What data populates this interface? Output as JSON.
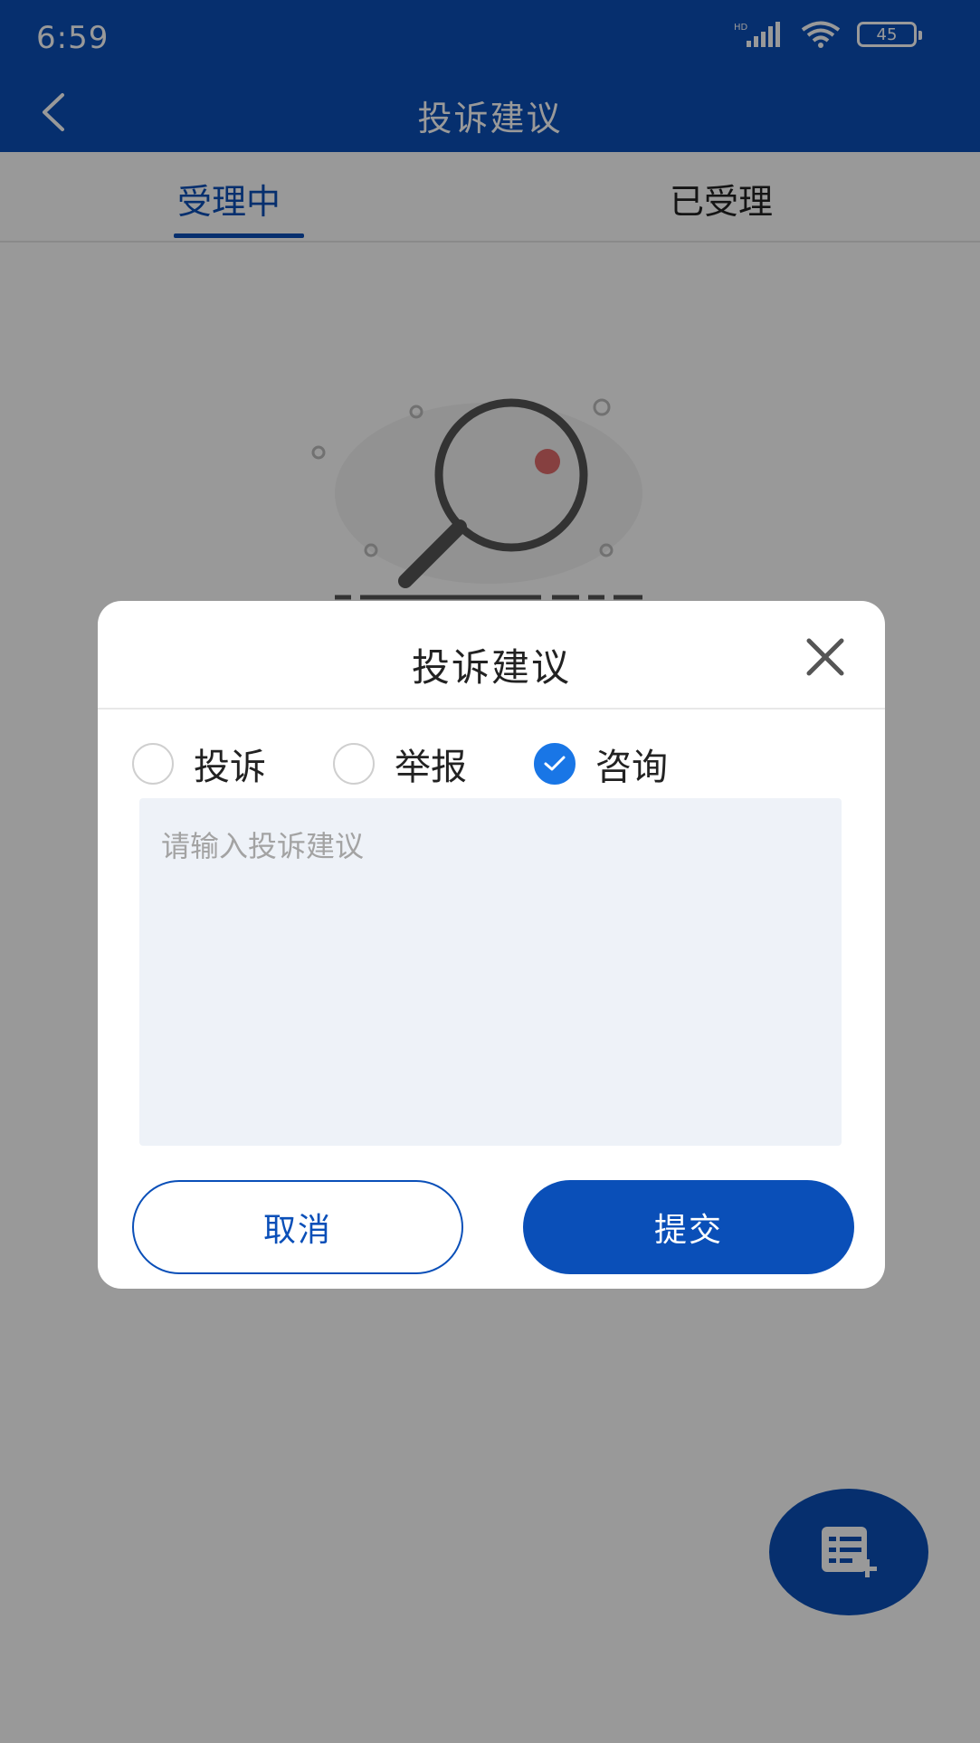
{
  "status_bar": {
    "time": "6:59",
    "network_label": "HD",
    "battery_level": "45"
  },
  "nav": {
    "title": "投诉建议"
  },
  "tabs": [
    {
      "label": "受理中",
      "active": true
    },
    {
      "label": "已受理",
      "active": false
    }
  ],
  "dialog": {
    "title": "投诉建议",
    "options": [
      {
        "label": "投诉",
        "checked": false
      },
      {
        "label": "举报",
        "checked": false
      },
      {
        "label": "咨询",
        "checked": true
      }
    ],
    "input": {
      "placeholder": "请输入投诉建议",
      "value": ""
    },
    "cancel_label": "取消",
    "submit_label": "提交"
  },
  "colors": {
    "brand": "#0a4fb8",
    "radio_checked": "#1976e6",
    "textarea_bg": "#eef2f8"
  },
  "icons": {
    "back": "chevron-left-icon",
    "close": "close-icon",
    "fab": "list-add-icon",
    "empty": "magnifier-icon"
  }
}
